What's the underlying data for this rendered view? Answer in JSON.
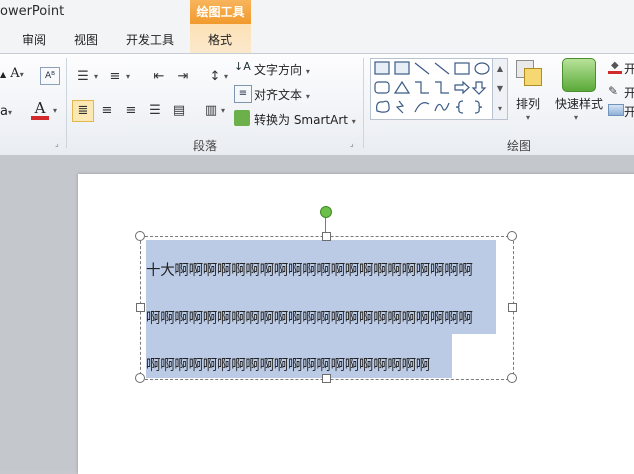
{
  "app": {
    "title": "owerPoint"
  },
  "contextual": {
    "header": "绘图工具"
  },
  "tabs": [
    {
      "label": "审阅"
    },
    {
      "label": "视图"
    },
    {
      "label": "开发工具"
    },
    {
      "label": "格式"
    }
  ],
  "ribbon": {
    "font_group": {
      "a_small": "A",
      "partial": "a",
      "font_color": "A",
      "red": "#d22a2a"
    },
    "paragraph_group": {
      "label": "段落",
      "text_direction": "文字方向",
      "align_text": "对齐文本",
      "convert_smartart": "转换为 SmartArt"
    },
    "drawing_group": {
      "label": "绘图",
      "arrange": "排列",
      "quick_styles": "快速样式",
      "right_cut_1": "开",
      "right_cut_2": "开",
      "right_cut_3": "开"
    }
  },
  "slide": {
    "textbox": {
      "line1": "十大啊啊啊啊啊啊啊啊啊啊啊啊啊啊啊啊啊啊啊啊啊",
      "line2": "啊啊啊啊啊啊啊啊啊啊啊啊啊啊啊啊啊啊啊啊啊啊啊",
      "line3": "啊啊啊啊啊啊啊啊啊啊啊啊啊啊啊啊啊啊啊啊"
    }
  },
  "colors": {
    "accent": "#f19a2c",
    "selection": "#bccbe5",
    "rotate_handle": "#6cc04a"
  }
}
